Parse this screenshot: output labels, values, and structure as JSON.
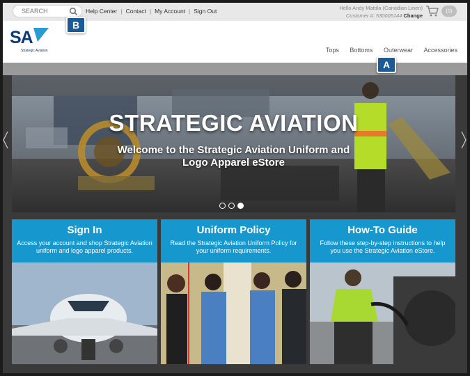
{
  "search": {
    "placeholder": "SEARCH"
  },
  "top_links": [
    "Help Center",
    "Contact",
    "My Account",
    "Sign Out"
  ],
  "user": {
    "greeting": "Hello Andy Mattila (Canadian Linen)",
    "customer_label": "Customer #:",
    "customer_number": "530005144",
    "change_label": "Change"
  },
  "cart": {
    "count": "(0)",
    "icon": "cart-icon"
  },
  "logo": {
    "mark": "SA",
    "subtitle": "Strategic Aviation"
  },
  "nav": [
    "Tops",
    "Bottoms",
    "Outerwear",
    "Accessories"
  ],
  "hero": {
    "title": "STRATEGIC AVIATION",
    "subtitle": "Welcome to the Strategic Aviation Uniform and Logo Apparel eStore",
    "slide_count": 3,
    "active_slide": 3
  },
  "cards": [
    {
      "title": "Sign In",
      "text": "Access your account and shop Strategic Aviation uniform and logo apparel products."
    },
    {
      "title": "Uniform Policy",
      "text": "Read the Strategic Aviation Uniform Policy for your uniform requirements."
    },
    {
      "title": "How-To Guide",
      "text": "Follow these step-by-step instructions to help you use the Strategic Aviation eStore."
    }
  ],
  "badges": {
    "a": "A",
    "b": "B"
  },
  "colors": {
    "card_blue": "#1697ce",
    "badge_blue": "#1c5a96",
    "logo_blue": "#0d3a78"
  }
}
